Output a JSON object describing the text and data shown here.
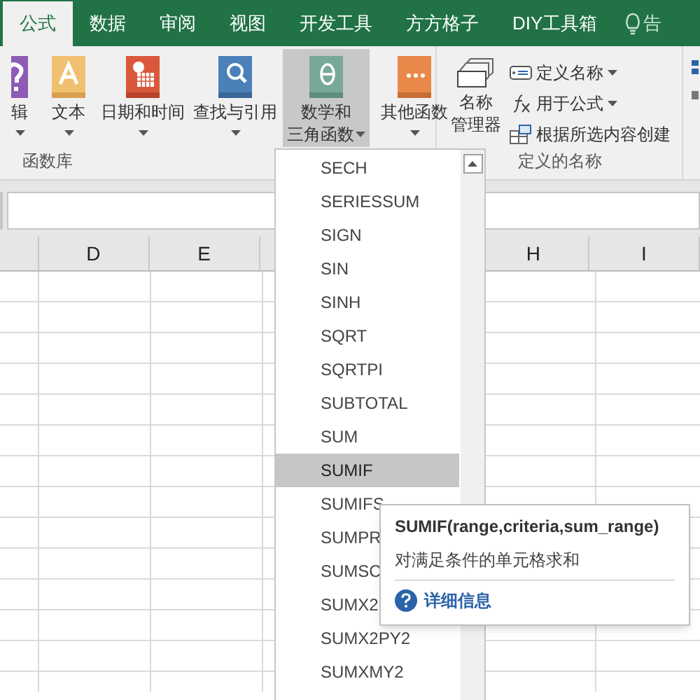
{
  "tabs": [
    {
      "label": "公式",
      "selected": true
    },
    {
      "label": "数据",
      "selected": false
    },
    {
      "label": "审阅",
      "selected": false
    },
    {
      "label": "视图",
      "selected": false
    },
    {
      "label": "开发工具",
      "selected": false
    },
    {
      "label": "方方格子",
      "selected": false
    },
    {
      "label": "DIY工具箱",
      "selected": false
    }
  ],
  "tell_me": "告",
  "function_library": {
    "label": "函数库",
    "buttons": [
      {
        "lines": [
          "辑"
        ],
        "expanded": false
      },
      {
        "lines": [
          "文本"
        ],
        "expanded": false
      },
      {
        "lines": [
          "日期和时间"
        ],
        "expanded": false
      },
      {
        "lines": [
          "查找与引用"
        ],
        "expanded": false
      },
      {
        "lines": [
          "数学和",
          "三角函数"
        ],
        "expanded": true
      },
      {
        "lines": [
          "其他函数"
        ],
        "expanded": false
      }
    ]
  },
  "defined_names": {
    "label": "定义的名称",
    "manager": [
      "名称",
      "管理器"
    ],
    "commands": [
      "定义名称",
      "用于公式",
      "根据所选内容创建"
    ]
  },
  "columns": [
    "D",
    "E",
    "H",
    "I"
  ],
  "menu": {
    "items": [
      {
        "label": "SECH",
        "selected": false
      },
      {
        "label": "SERIESSUM",
        "selected": false
      },
      {
        "label": "SIGN",
        "selected": false
      },
      {
        "label": "SIN",
        "selected": false
      },
      {
        "label": "SINH",
        "selected": false
      },
      {
        "label": "SQRT",
        "selected": false
      },
      {
        "label": "SQRTPI",
        "selected": false
      },
      {
        "label": "SUBTOTAL",
        "selected": false
      },
      {
        "label": "SUM",
        "selected": false
      },
      {
        "label": "SUMIF",
        "selected": true
      },
      {
        "label": "SUMIFS",
        "selected": false
      },
      {
        "label": "SUMPR",
        "selected": false
      },
      {
        "label": "SUMSC",
        "selected": false
      },
      {
        "label": "SUMX2",
        "selected": false
      },
      {
        "label": "SUMX2PY2",
        "selected": false
      },
      {
        "label": "SUMXMY2",
        "selected": false
      }
    ]
  },
  "tooltip": {
    "title": "SUMIF(range,criteria,sum_range)",
    "description": "对满足条件的单元格求和",
    "link": "详细信息"
  }
}
